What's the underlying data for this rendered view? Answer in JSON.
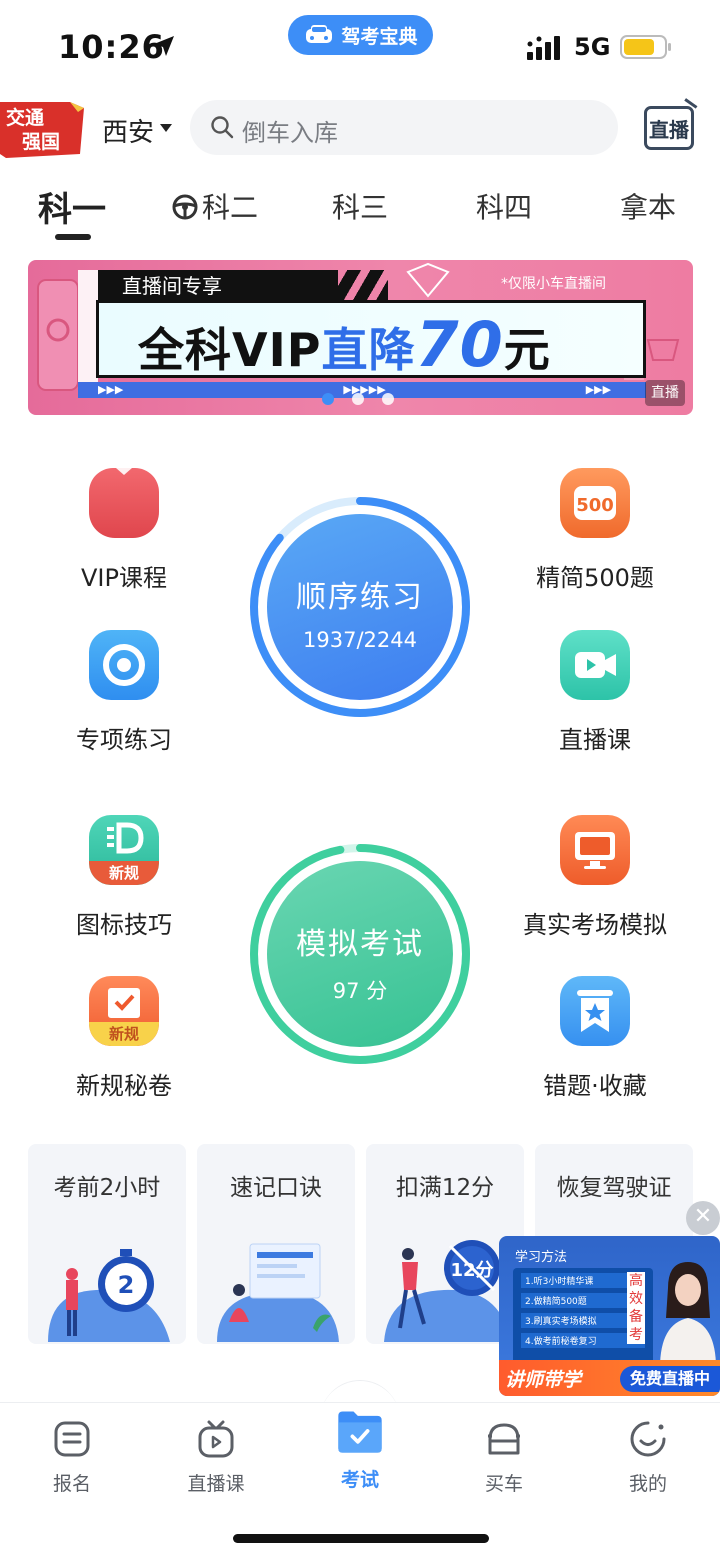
{
  "status_bar": {
    "time": "10:26",
    "network": "5G"
  },
  "app_pill": {
    "label": "驾考宝典"
  },
  "header": {
    "badge_text": [
      "交通",
      "强国"
    ],
    "city": "西安",
    "search_placeholder": "倒车入库",
    "live_button_label": "直播"
  },
  "tabs": [
    {
      "label": "科一",
      "active": true
    },
    {
      "label": "科二",
      "icon": "steering-wheel-icon"
    },
    {
      "label": "科三"
    },
    {
      "label": "科四"
    },
    {
      "label": "拿本"
    }
  ],
  "banner": {
    "tag": "直播间专享",
    "note": "*仅限小车直播间",
    "title_prefix": "全科VIP",
    "title_highlight": "直降",
    "title_number": "70",
    "title_suffix": "元",
    "live_label": "直播",
    "current_slide": 1,
    "slide_count": 3
  },
  "features": {
    "vip_course": "VIP课程",
    "special_practice": "专项练习",
    "simplified_500": "精简500题",
    "simplified_500_icon_text": "500",
    "live_course": "直播课",
    "sign_tips": "图标技巧",
    "new_rules_secret": "新规秘卷",
    "real_exam_sim": "真实考场模拟",
    "mistakes_favorites": "错题·收藏",
    "new_tag": "新规"
  },
  "sequential_practice": {
    "title": "顺序练习",
    "progress": "1937/2244",
    "progress_fraction": 0.863
  },
  "mock_exam": {
    "title": "模拟考试",
    "score": "97 分",
    "score_fraction": 0.97
  },
  "quick_cards": [
    {
      "title": "考前2小时",
      "art_text": "2"
    },
    {
      "title": "速记口诀"
    },
    {
      "title": "扣满12分",
      "art_text": "12分"
    },
    {
      "title": "恢复驾驶证"
    }
  ],
  "live_float": {
    "title": "学习方法",
    "board_lines": [
      "1.听3小时精华课",
      "2.做精简500题",
      "3.刷真实考场模拟",
      "4.做考前秘卷复习"
    ],
    "vertical_text": "高效备考",
    "bottom_left": "讲师带学",
    "bottom_right": "免费直播中"
  },
  "bottom_nav": [
    {
      "label": "报名",
      "icon": "signup-icon"
    },
    {
      "label": "直播课",
      "icon": "tv-icon"
    },
    {
      "label": "考试",
      "icon": "exam-folder-icon",
      "active": true
    },
    {
      "label": "买车",
      "icon": "car-icon"
    },
    {
      "label": "我的",
      "icon": "profile-icon"
    }
  ],
  "colors": {
    "accent_blue": "#3d8ef7",
    "practice_blue": "#4a90f0",
    "exam_green": "#3fcf9e",
    "banner_pink": "#e56b9a"
  }
}
